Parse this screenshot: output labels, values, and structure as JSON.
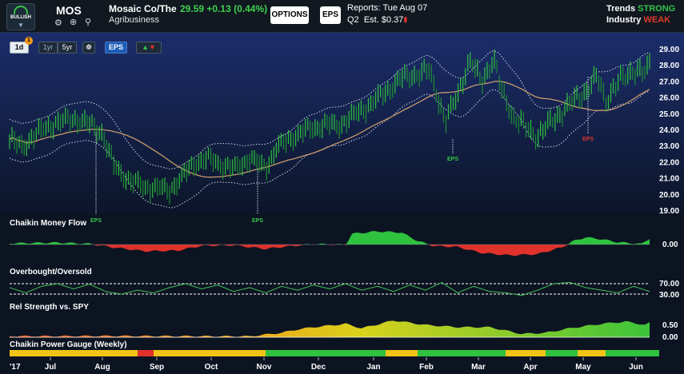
{
  "header": {
    "badge_label": "BULLISH",
    "ticker": "MOS",
    "company": "Mosaic Co/The",
    "industry_name": "Agribusiness",
    "price": "29.59",
    "change": "+0.13",
    "change_pct": "(0.44%)",
    "options_label": "OPTIONS",
    "eps_label": "EPS",
    "reports_label": "Reports:",
    "reports_date": "Tue Aug 07",
    "quarter": "Q2",
    "est_label": "Est.",
    "est_value": "$0.37",
    "trends_label": "Trends",
    "trends_value": "STRONG",
    "industry_label": "Industry",
    "industry_value": "WEAK"
  },
  "controls": {
    "period_1d": "1d",
    "alert_count": "1",
    "period_1yr": "1yr",
    "period_5yr": "5yr",
    "eps_toggle": "EPS"
  },
  "panels": {
    "cmf_title": "Chaikin Money Flow",
    "obos_title": "Overbought/Oversold",
    "rel_title": "Rel Strength vs. SPY",
    "gauge_title": "Chaikin Power Gauge (Weekly)",
    "cmf_tick": "0.00",
    "obos_ticks": [
      "70.00",
      "30.00"
    ],
    "rel_ticks": [
      "0.50",
      "0.00"
    ]
  },
  "colors": {
    "up": "#2fc23f",
    "down": "#e0312a",
    "neutral": "#f2c417",
    "sma": "#c89a6a",
    "bands": "#cfd6e6",
    "eps_green": "#37c94a",
    "eps_red": "#e0312a"
  },
  "chart_data": {
    "type": "bar",
    "y_ticks": [
      "29.00",
      "28.00",
      "27.00",
      "26.00",
      "25.00",
      "24.00",
      "23.00",
      "22.00",
      "21.00",
      "20.00",
      "19.00"
    ],
    "ylim": [
      18.5,
      29.5
    ],
    "x_labels": [
      "'17",
      "Jul",
      "Aug",
      "Sep",
      "Oct",
      "Nov",
      "Dec",
      "Jan",
      "Feb",
      "Mar",
      "Apr",
      "May",
      "Jun"
    ],
    "eps_markers": [
      {
        "label": "EPS",
        "price": 23.7,
        "color": "green"
      },
      {
        "label": "EPS",
        "price": 21.2,
        "color": "green"
      },
      {
        "label": "EPS",
        "price": 23.2,
        "color": "green"
      },
      {
        "label": "EPS",
        "price": 27.4,
        "color": "red"
      }
    ],
    "price_keypoints": [
      [
        0,
        23.2
      ],
      [
        15,
        22.7
      ],
      [
        30,
        23.4
      ],
      [
        45,
        24.0
      ],
      [
        60,
        24.3
      ],
      [
        80,
        24.6
      ],
      [
        100,
        24.2
      ],
      [
        115,
        23.7
      ],
      [
        130,
        21.5
      ],
      [
        150,
        20.4
      ],
      [
        170,
        20.0
      ],
      [
        185,
        19.9
      ],
      [
        200,
        19.8
      ],
      [
        215,
        20.6
      ],
      [
        230,
        21.6
      ],
      [
        250,
        21.9
      ],
      [
        265,
        21.5
      ],
      [
        280,
        21.2
      ],
      [
        300,
        21.9
      ],
      [
        320,
        21.3
      ],
      [
        335,
        22.7
      ],
      [
        355,
        23.4
      ],
      [
        375,
        23.9
      ],
      [
        395,
        24.2
      ],
      [
        410,
        24.1
      ],
      [
        430,
        24.8
      ],
      [
        450,
        25.5
      ],
      [
        470,
        26.4
      ],
      [
        490,
        27.3
      ],
      [
        510,
        27.6
      ],
      [
        525,
        27.8
      ],
      [
        545,
        24.4
      ],
      [
        560,
        26.2
      ],
      [
        575,
        28.5
      ],
      [
        590,
        27.1
      ],
      [
        605,
        28.6
      ],
      [
        615,
        26.5
      ],
      [
        630,
        24.7
      ],
      [
        645,
        24.0
      ],
      [
        660,
        23.4
      ],
      [
        675,
        24.3
      ],
      [
        690,
        25.0
      ],
      [
        705,
        25.8
      ],
      [
        720,
        26.4
      ],
      [
        735,
        27.4
      ],
      [
        745,
        25.8
      ],
      [
        760,
        27.0
      ],
      [
        780,
        27.9
      ],
      [
        795,
        27.6
      ],
      [
        810,
        29.6
      ]
    ],
    "cmf_keypoints": [
      [
        0,
        0.05
      ],
      [
        60,
        0.08
      ],
      [
        100,
        0.03
      ],
      [
        130,
        -0.12
      ],
      [
        170,
        -0.28
      ],
      [
        210,
        -0.25
      ],
      [
        240,
        -0.05
      ],
      [
        280,
        -0.03
      ],
      [
        320,
        -0.18
      ],
      [
        340,
        -0.1
      ],
      [
        380,
        0.02
      ],
      [
        420,
        -0.01
      ],
      [
        428,
        0.45
      ],
      [
        460,
        0.55
      ],
      [
        490,
        0.5
      ],
      [
        510,
        0.15
      ],
      [
        530,
        -0.06
      ],
      [
        560,
        -0.1
      ],
      [
        590,
        -0.35
      ],
      [
        625,
        -0.45
      ],
      [
        660,
        -0.4
      ],
      [
        690,
        -0.12
      ],
      [
        705,
        0.15
      ],
      [
        720,
        0.3
      ],
      [
        740,
        0.22
      ],
      [
        760,
        0.1
      ],
      [
        790,
        0.02
      ],
      [
        810,
        0.5
      ]
    ],
    "obos_keypoints": [
      [
        0,
        55
      ],
      [
        20,
        35
      ],
      [
        40,
        60
      ],
      [
        60,
        70
      ],
      [
        80,
        50
      ],
      [
        100,
        68
      ],
      [
        120,
        40
      ],
      [
        140,
        30
      ],
      [
        160,
        45
      ],
      [
        180,
        35
      ],
      [
        200,
        55
      ],
      [
        220,
        70
      ],
      [
        240,
        50
      ],
      [
        260,
        65
      ],
      [
        280,
        40
      ],
      [
        300,
        55
      ],
      [
        320,
        35
      ],
      [
        340,
        60
      ],
      [
        360,
        45
      ],
      [
        380,
        65
      ],
      [
        400,
        50
      ],
      [
        420,
        70
      ],
      [
        440,
        45
      ],
      [
        460,
        60
      ],
      [
        480,
        40
      ],
      [
        500,
        65
      ],
      [
        520,
        45
      ],
      [
        540,
        75
      ],
      [
        560,
        35
      ],
      [
        580,
        60
      ],
      [
        600,
        40
      ],
      [
        620,
        35
      ],
      [
        640,
        25
      ],
      [
        660,
        45
      ],
      [
        680,
        70
      ],
      [
        700,
        75
      ],
      [
        720,
        55
      ],
      [
        740,
        45
      ],
      [
        760,
        35
      ],
      [
        780,
        60
      ],
      [
        800,
        40
      ],
      [
        810,
        55
      ]
    ],
    "rel_keypoints": [
      [
        0,
        0.05
      ],
      [
        60,
        0.05
      ],
      [
        120,
        0.06
      ],
      [
        200,
        0.05
      ],
      [
        300,
        0.04
      ],
      [
        340,
        0.2
      ],
      [
        360,
        0.35
      ],
      [
        380,
        0.45
      ],
      [
        420,
        0.6
      ],
      [
        440,
        0.4
      ],
      [
        480,
        0.75
      ],
      [
        520,
        0.55
      ],
      [
        560,
        0.45
      ],
      [
        600,
        0.45
      ],
      [
        640,
        0.15
      ],
      [
        670,
        0.2
      ],
      [
        700,
        0.4
      ],
      [
        740,
        0.6
      ],
      [
        770,
        0.7
      ],
      [
        795,
        0.55
      ],
      [
        810,
        0.85
      ]
    ],
    "gauge_segments": [
      {
        "from": 0,
        "to": 160,
        "rating": "neutral"
      },
      {
        "from": 160,
        "to": 180,
        "rating": "bearish"
      },
      {
        "from": 180,
        "to": 320,
        "rating": "neutral"
      },
      {
        "from": 320,
        "to": 470,
        "rating": "bullish"
      },
      {
        "from": 470,
        "to": 510,
        "rating": "neutral"
      },
      {
        "from": 510,
        "to": 620,
        "rating": "bullish"
      },
      {
        "from": 620,
        "to": 670,
        "rating": "neutral"
      },
      {
        "from": 670,
        "to": 710,
        "rating": "bullish"
      },
      {
        "from": 710,
        "to": 745,
        "rating": "neutral"
      },
      {
        "from": 745,
        "to": 812,
        "rating": "bullish"
      }
    ]
  }
}
